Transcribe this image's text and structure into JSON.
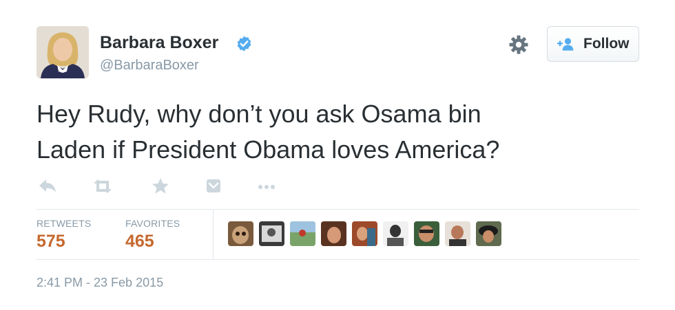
{
  "user": {
    "name": "Barbara Boxer",
    "handle": "@BarbaraBoxer",
    "verified": true,
    "avatar_icon": "profile-photo-icon"
  },
  "header": {
    "settings_icon": "gear-icon",
    "follow_label": "Follow",
    "follow_icon": "add-user-icon"
  },
  "tweet": {
    "text_line1": "Hey Rudy, why don’t you ask Osama bin",
    "text_line2": "Laden if President Obama loves America?"
  },
  "actions": [
    "reply-icon",
    "retweet-icon",
    "favorite-icon",
    "pocket-icon",
    "more-icon"
  ],
  "stats": {
    "retweets_label": "RETWEETS",
    "retweets_value": "575",
    "favorites_label": "FAVORITES",
    "favorites_value": "465"
  },
  "favoriters_count_shown": 9,
  "timestamp": "2:41 PM - 23 Feb 2015",
  "colors": {
    "text": "#292f33",
    "muted": "#8899a6",
    "stat_value": "#c5692e",
    "verified": "#55acee",
    "divider": "#e1e8ed",
    "action_icon": "#ccd6dd"
  }
}
